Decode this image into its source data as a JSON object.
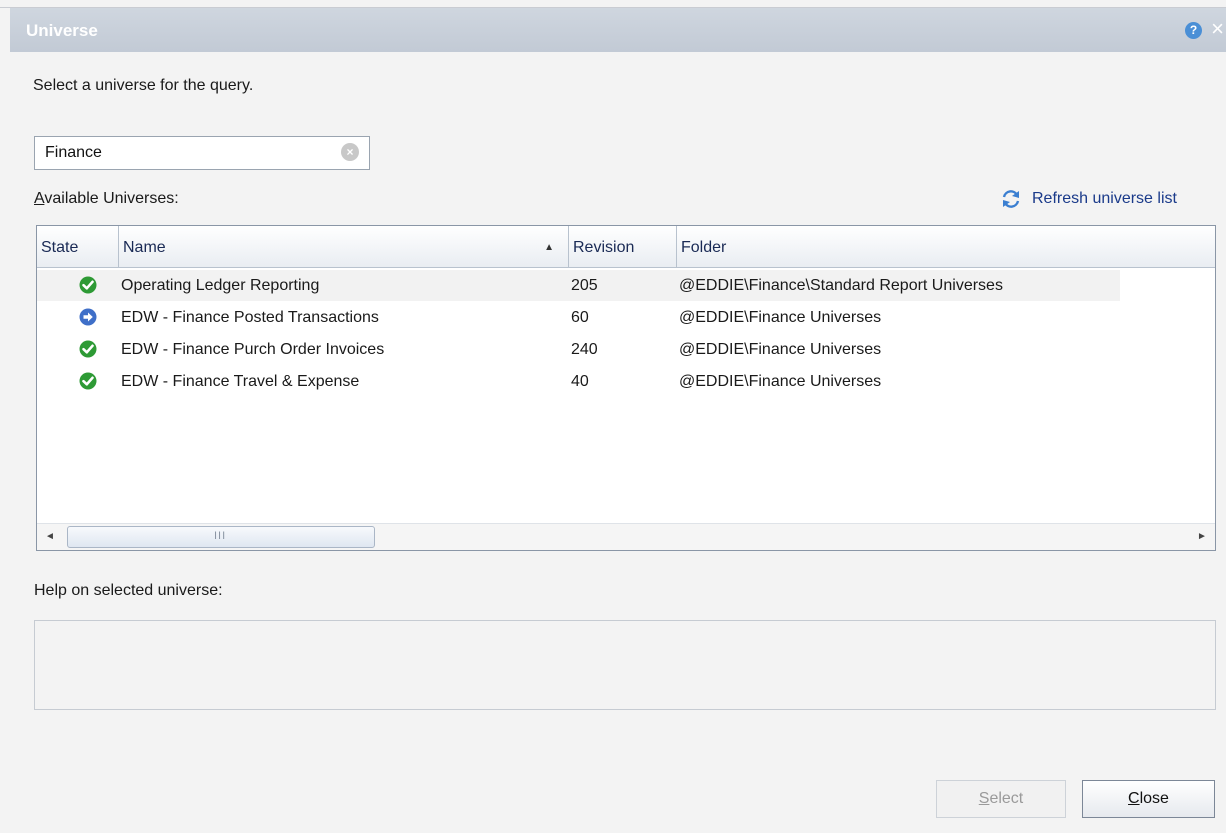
{
  "dialog": {
    "title": "Universe",
    "help_icon": "help-icon",
    "close_icon": "close-icon"
  },
  "instruction": "Select a universe for the query.",
  "search": {
    "value": "Finance",
    "clear_icon": "clear-icon"
  },
  "available_label": {
    "first_letter": "A",
    "rest": "vailable Universes:"
  },
  "refresh_label": "Refresh universe list",
  "table": {
    "columns": {
      "state": "State",
      "name": "Name",
      "revision": "Revision",
      "folder": "Folder"
    },
    "sort": "ascending",
    "rows": [
      {
        "state": "check",
        "name": "Operating Ledger Reporting",
        "revision": "205",
        "folder": "@EDDIE\\Finance\\Standard Report Universes"
      },
      {
        "state": "arrow",
        "name": "EDW - Finance Posted Transactions",
        "revision": "60",
        "folder": "@EDDIE\\Finance Universes"
      },
      {
        "state": "check",
        "name": "EDW - Finance Purch Order Invoices",
        "revision": "240",
        "folder": "@EDDIE\\Finance Universes"
      },
      {
        "state": "check",
        "name": "EDW - Finance Travel & Expense",
        "revision": "40",
        "folder": "@EDDIE\\Finance Universes"
      }
    ]
  },
  "help_label": "Help on selected universe:",
  "buttons": {
    "select": {
      "mnemonic": "S",
      "rest": "elect"
    },
    "close": {
      "mnemonic": "C",
      "rest": "lose"
    }
  },
  "colors": {
    "check": "#2e9a35",
    "arrow": "#3f6fc8"
  }
}
